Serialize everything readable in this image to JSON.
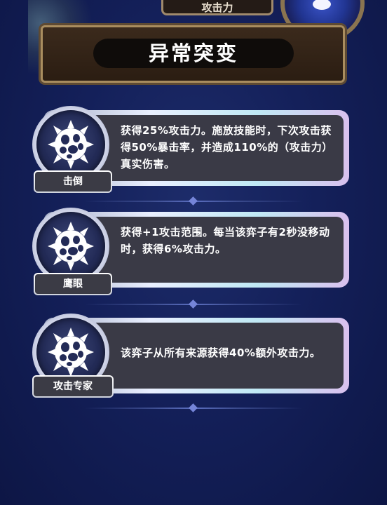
{
  "header": {
    "top_tab_label": "攻击力",
    "title": "异常突变"
  },
  "abilities": [
    {
      "label": "击倒",
      "description": "获得25%攻击力。施放技能时，下次攻击获得50%暴击率，并造成110%的（攻击力）真实伤害。"
    },
    {
      "label": "鹰眼",
      "description": "获得+1攻击范围。每当该弈子有2秒没移动时，获得6%攻击力。"
    },
    {
      "label": "攻击专家",
      "description": "该弈子从所有来源获得40%额外攻击力。"
    }
  ]
}
